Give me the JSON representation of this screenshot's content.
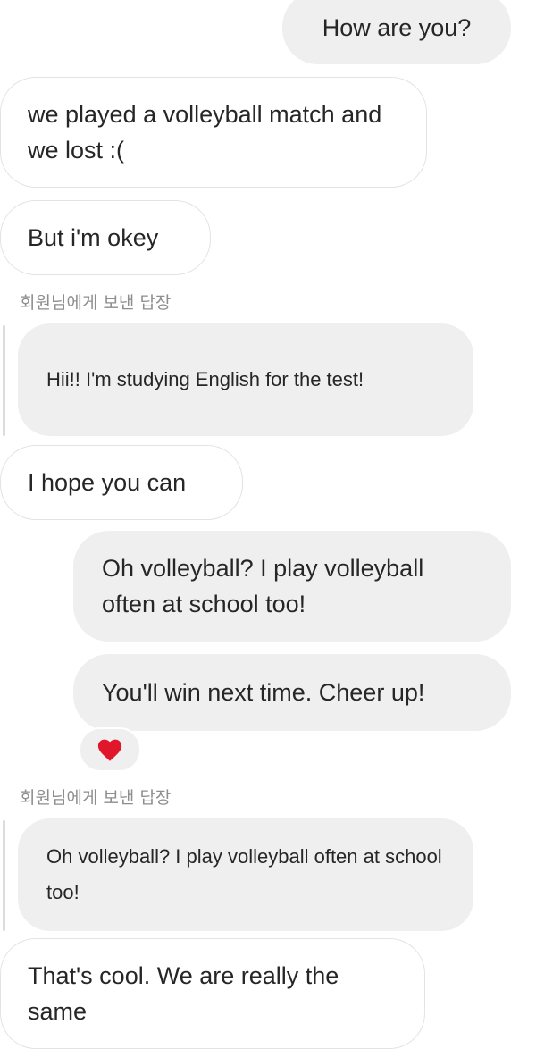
{
  "messages": {
    "m1": "How are you?",
    "m2": "we played a volleyball match and we lost :(",
    "m3": "But i'm okey",
    "reply1_label": "회원님에게 보낸 답장",
    "reply1_quote": "Hii!! I'm studying English for the test!",
    "m4": "I hope you can",
    "m5": "Oh volleyball? I play volleyball often at school too!",
    "m6": "You'll win next time. Cheer up!",
    "reply2_label": "회원님에게 보낸 답장",
    "reply2_quote": "Oh volleyball? I play volleyball often at school too!",
    "m7": "That's cool. We are really the same"
  },
  "icons": {
    "reaction": "heart-icon"
  },
  "colors": {
    "sent_bubble": "#efefef",
    "received_border": "#e3e3e3",
    "reply_label": "#8e8e8e",
    "heart": "#e0162b"
  }
}
